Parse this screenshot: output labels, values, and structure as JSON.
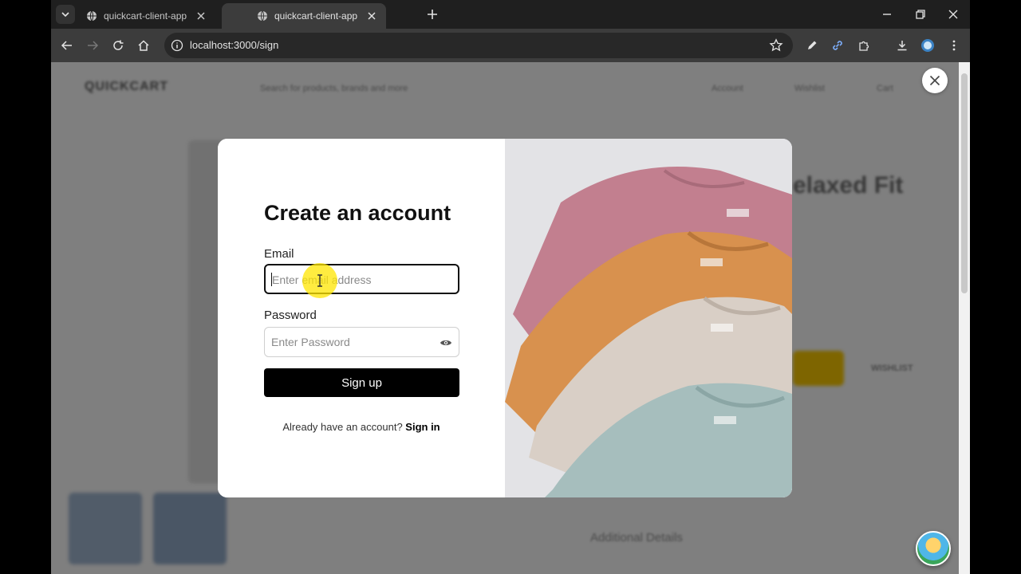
{
  "browser": {
    "tabs": [
      {
        "title": "quickcart-client-app",
        "active": false
      },
      {
        "title": "quickcart-client-app",
        "active": true
      }
    ],
    "url": "localhost:3000/sign"
  },
  "background_page": {
    "logo": "QUICKCART",
    "search_placeholder": "Search for products, brands and more",
    "nav": [
      "Account",
      "Wishlist",
      "Cart"
    ],
    "product_title": "elaxed Fit",
    "wishlist_btn": "WISHLIST",
    "additional_details": "Additional Details"
  },
  "modal": {
    "title": "Create an account",
    "email_label": "Email",
    "email_placeholder": "Enter email address",
    "password_label": "Password",
    "password_placeholder": "Enter Password",
    "submit_label": "Sign up",
    "switch_prompt": "Already have an account?",
    "switch_link": "Sign in"
  },
  "colors": {
    "accent": "#000000",
    "highlight": "#ffe600"
  }
}
